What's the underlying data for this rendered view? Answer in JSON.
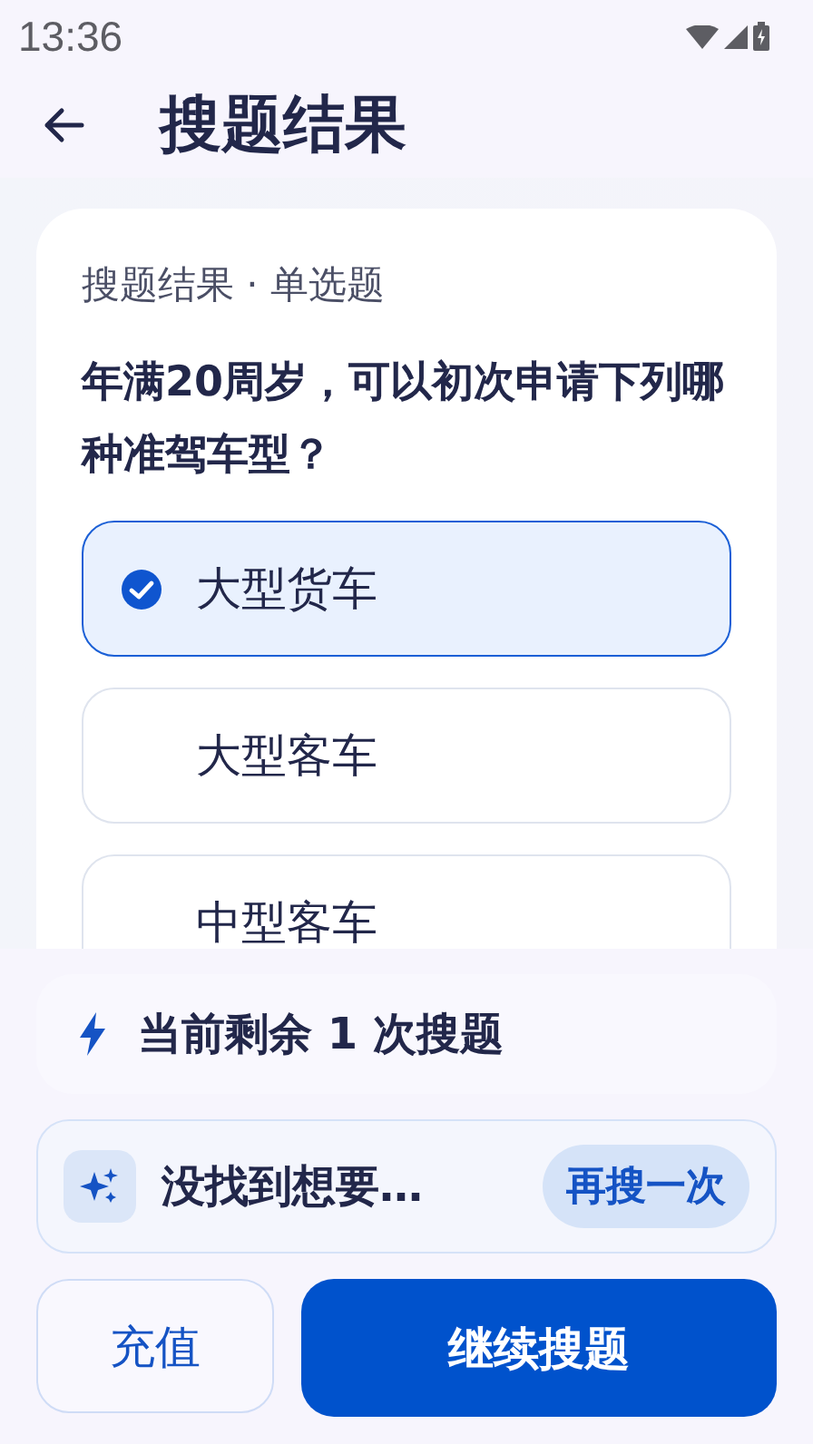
{
  "status_bar": {
    "time": "13:36"
  },
  "header": {
    "title": "搜题结果"
  },
  "result": {
    "label": "搜题结果 · 单选题",
    "question": "年满20周岁，可以初次申请下列哪种准驾车型？",
    "options": [
      {
        "text": "大型货车",
        "selected": true
      },
      {
        "text": "大型客车",
        "selected": false
      },
      {
        "text": "中型客车",
        "selected": false
      }
    ]
  },
  "remaining": {
    "text": "当前剩余 1 次搜题"
  },
  "retry": {
    "text": "没找到想要…",
    "button": "再搜一次"
  },
  "buttons": {
    "recharge": "充值",
    "continue": "继续搜题"
  }
}
